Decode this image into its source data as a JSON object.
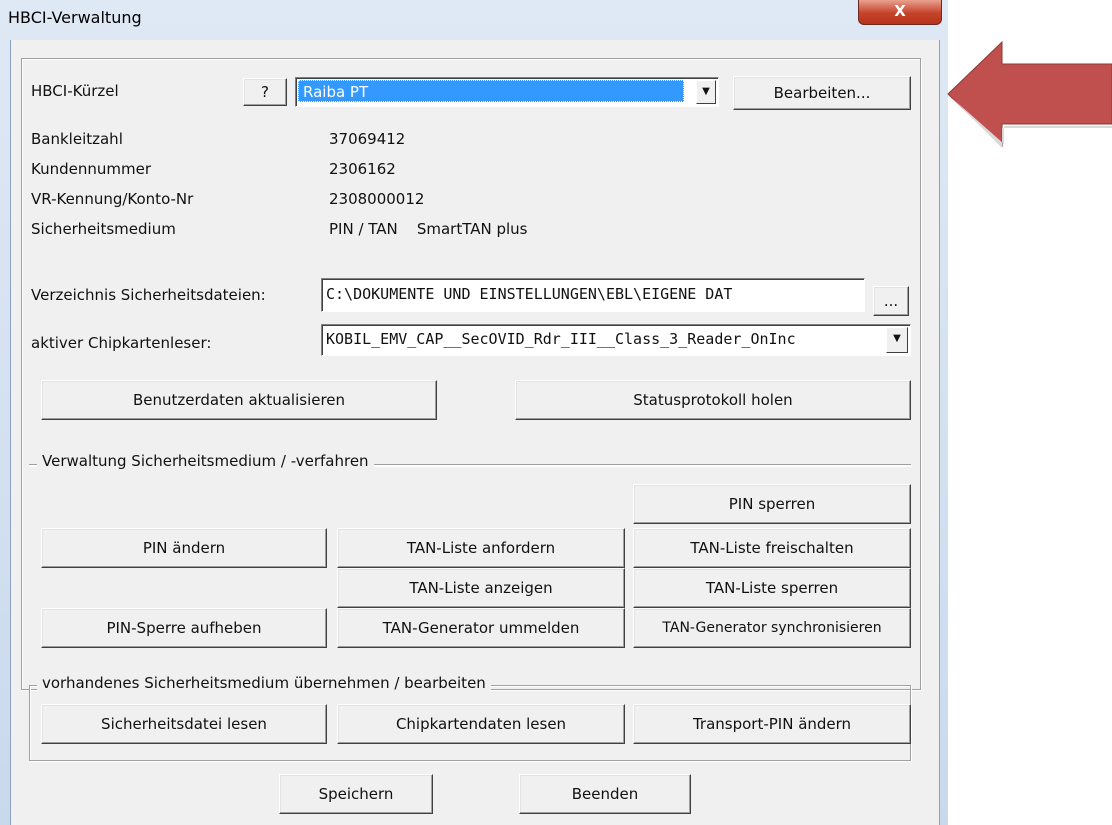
{
  "window": {
    "title": "HBCI-Verwaltung",
    "close_label": "X"
  },
  "header": {
    "kuerzel_label": "HBCI-Kürzel",
    "help_label": "?",
    "kuerzel_value": "Raiba PT",
    "edit_label": "Bearbeiten..."
  },
  "info": [
    {
      "label": "Bankleitzahl",
      "value": "37069412"
    },
    {
      "label": "Kundennummer",
      "value": "2306162"
    },
    {
      "label": "VR-Kennung/Konto-Nr",
      "value": "2308000012"
    },
    {
      "label": "Sicherheitsmedium",
      "value": "PIN / TAN    SmartTAN plus"
    }
  ],
  "paths": {
    "dir_label": "Verzeichnis Sicherheitsdateien:",
    "dir_value": "C:\\DOKUMENTE UND EINSTELLUNGEN\\EBL\\EIGENE DAT",
    "browse_label": "...",
    "reader_label": "aktiver Chipkartenleser:",
    "reader_value": "KOBIL_EMV_CAP__SecOVID_Rdr_III__Class_3_Reader_OnInc"
  },
  "actions": {
    "update_user": "Benutzerdaten aktualisieren",
    "status_log": "Statusprotokoll holen"
  },
  "group_security": {
    "title": "Verwaltung Sicherheitsmedium / -verfahren",
    "pin_lock": "PIN sperren",
    "pin_change": "PIN ändern",
    "tan_request": "TAN-Liste anfordern",
    "tan_unlock": "TAN-Liste freischalten",
    "tan_show": "TAN-Liste anzeigen",
    "tan_lock": "TAN-Liste sperren",
    "pin_unlock": "PIN-Sperre aufheben",
    "gen_reregister": "TAN-Generator ummelden",
    "gen_sync": "TAN-Generator synchronisieren"
  },
  "group_existing": {
    "title": "vorhandenes Sicherheitsmedium übernehmen / bearbeiten",
    "read_file": "Sicherheitsdatei lesen",
    "read_chip": "Chipkartendaten lesen",
    "transport_pin": "Transport-PIN ändern"
  },
  "footer": {
    "save": "Speichern",
    "exit": "Beenden"
  },
  "colors": {
    "arrow": "#c0504d",
    "selection": "#3399ff"
  }
}
